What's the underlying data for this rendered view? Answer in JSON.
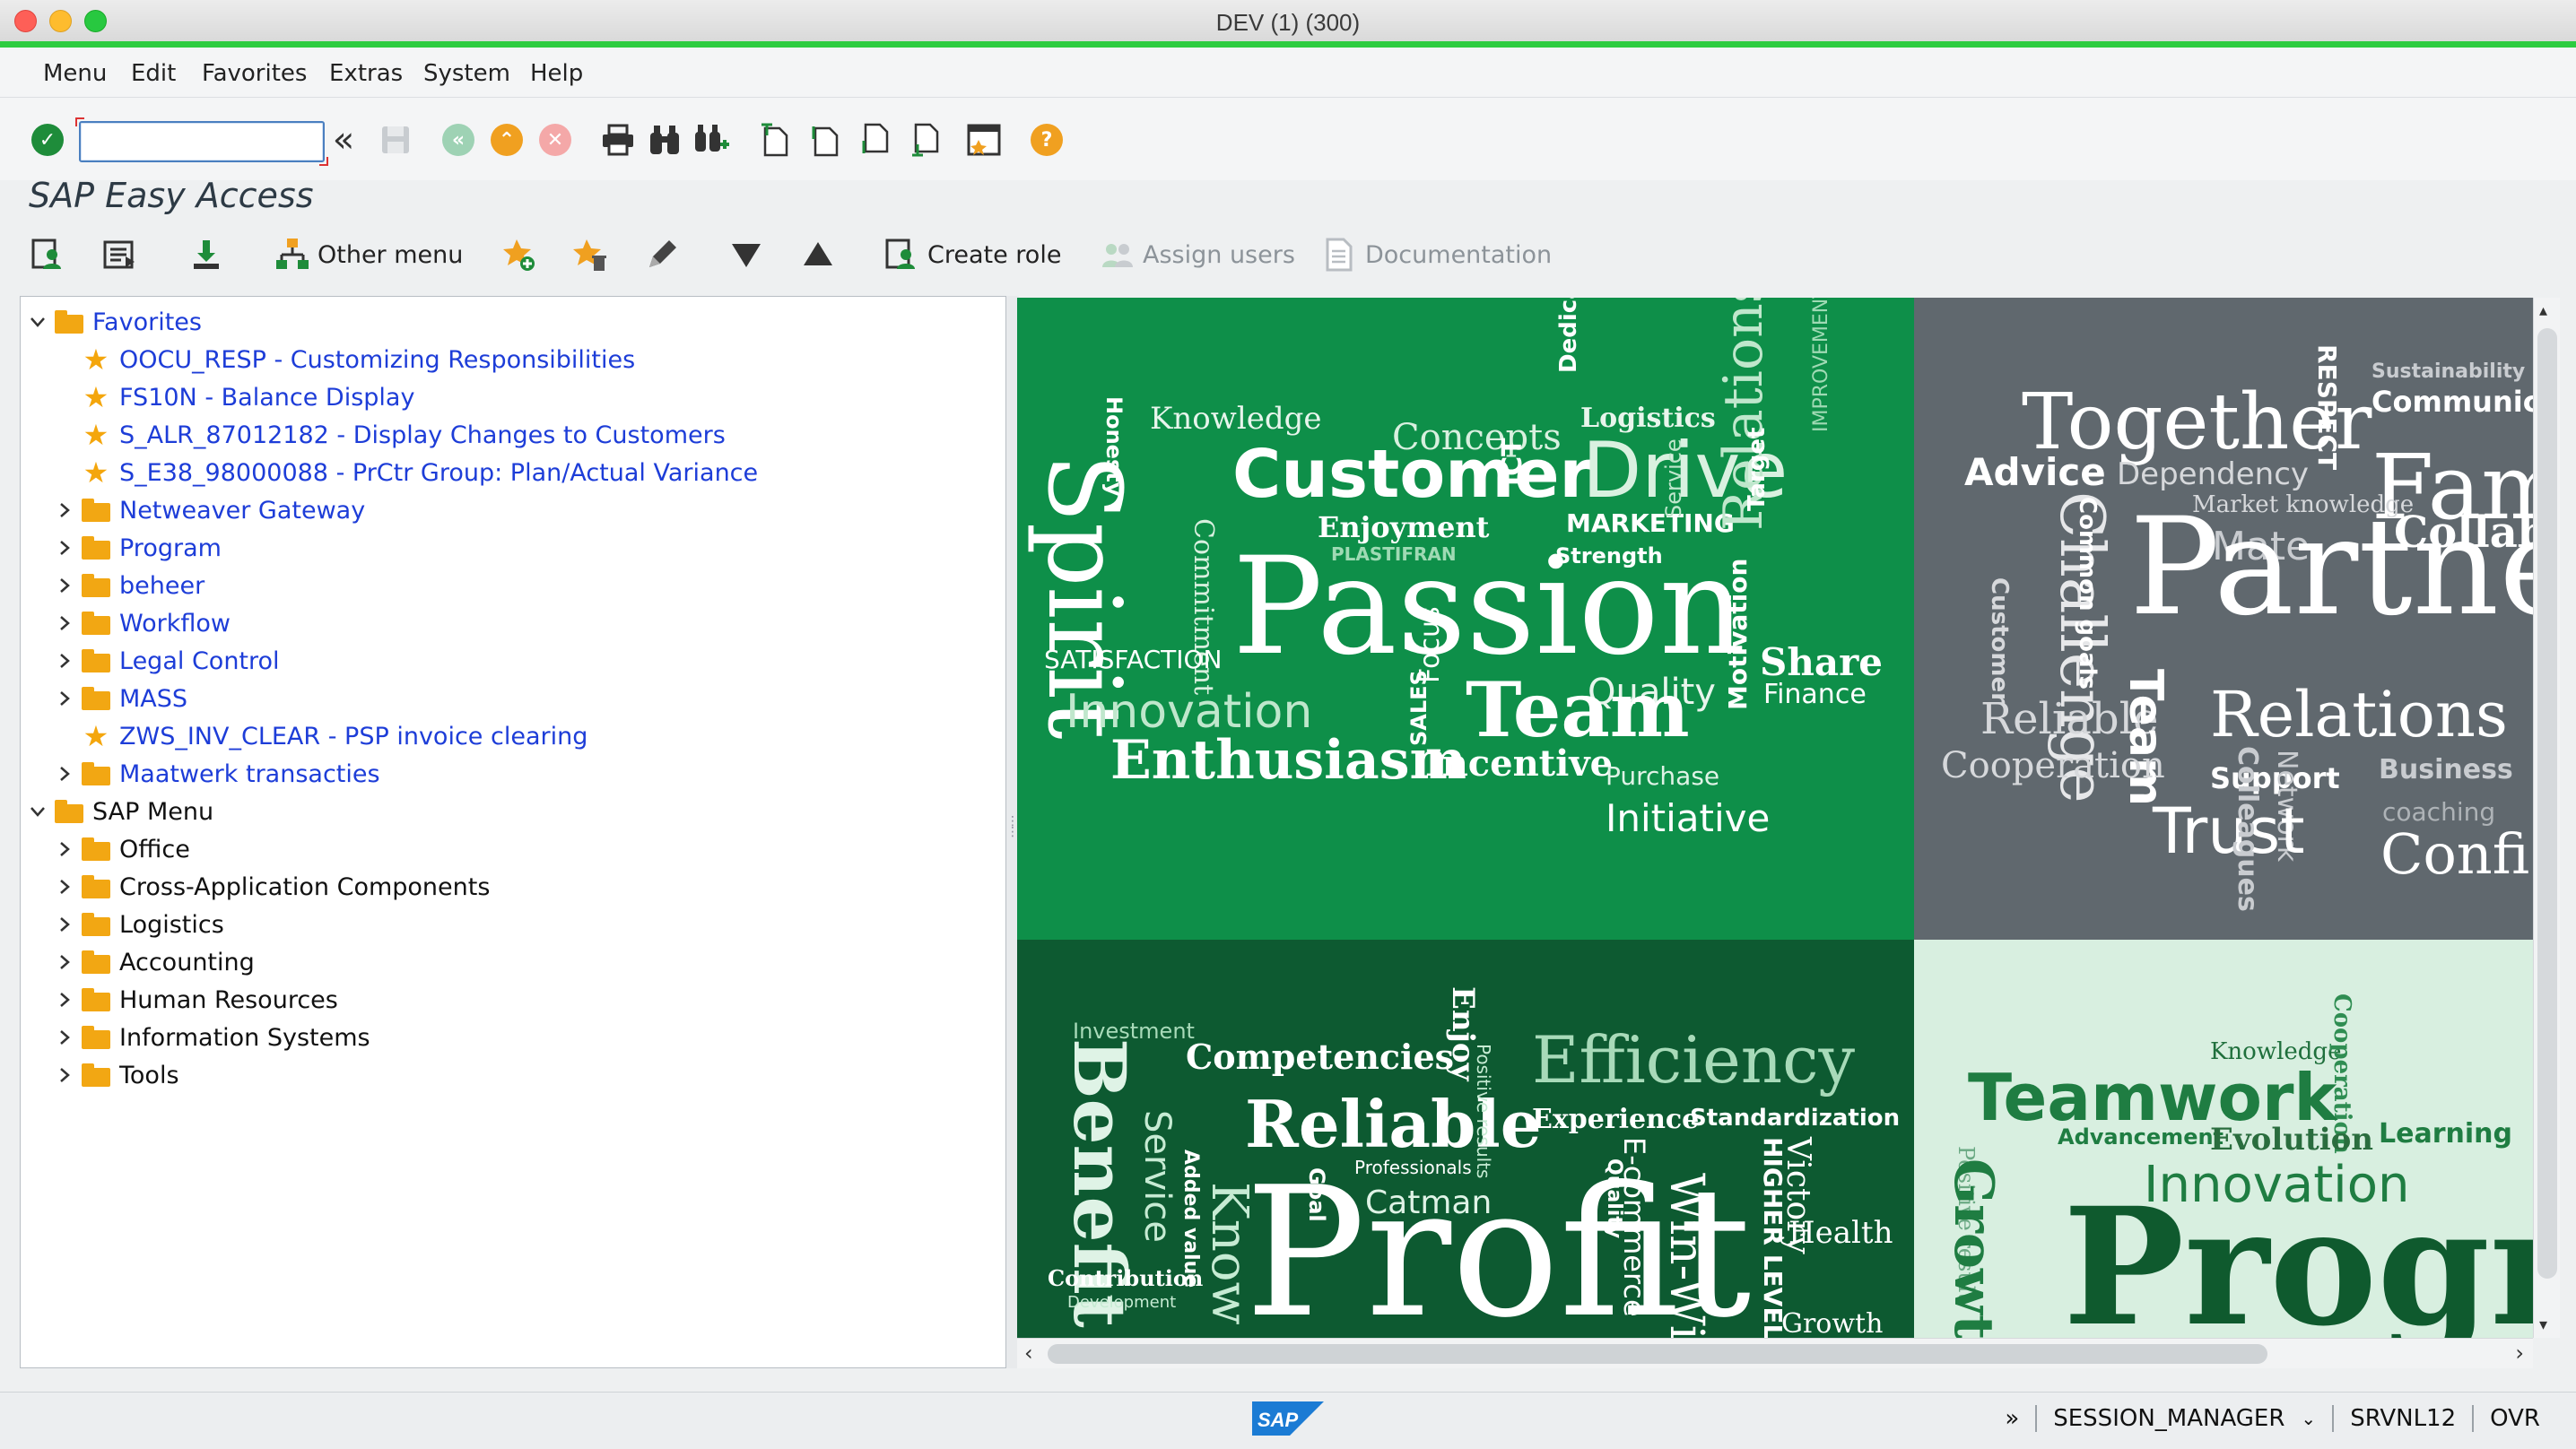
{
  "window": {
    "title": "DEV (1) (300)"
  },
  "menubar": {
    "items": [
      "Menu",
      "Edit",
      "Favorites",
      "Extras",
      "System",
      "Help"
    ]
  },
  "toolbar": {
    "command_field_value": "",
    "icons": [
      "enter-icon",
      "back-double-chevron-icon",
      "save-icon",
      "back-icon",
      "exit-icon",
      "cancel-icon",
      "print-icon",
      "find-icon",
      "find-next-icon",
      "first-page-icon",
      "previous-page-icon",
      "next-page-icon",
      "last-page-icon",
      "create-session-icon",
      "help-icon"
    ]
  },
  "page": {
    "title": "SAP Easy Access"
  },
  "apptoolbar": {
    "other_menu": "Other menu",
    "create_role": "Create role",
    "assign_users": "Assign users",
    "documentation": "Documentation"
  },
  "tree": {
    "favorites_label": "Favorites",
    "favorites": [
      {
        "kind": "star",
        "label": "OOCU_RESP - Customizing Responsibilities"
      },
      {
        "kind": "star",
        "label": "FS10N - Balance Display"
      },
      {
        "kind": "star",
        "label": "S_ALR_87012182 - Display Changes to Customers"
      },
      {
        "kind": "star",
        "label": "S_E38_98000088 - PrCtr Group: Plan/Actual Variance"
      },
      {
        "kind": "folder",
        "label": "Netweaver Gateway"
      },
      {
        "kind": "folder",
        "label": "Program"
      },
      {
        "kind": "folder",
        "label": "beheer"
      },
      {
        "kind": "folder",
        "label": "Workflow"
      },
      {
        "kind": "folder",
        "label": "Legal Control"
      },
      {
        "kind": "folder",
        "label": "MASS"
      },
      {
        "kind": "star",
        "label": "ZWS_INV_CLEAR - PSP invoice clearing"
      },
      {
        "kind": "folder",
        "label": "Maatwerk transacties"
      }
    ],
    "sap_menu_label": "SAP Menu",
    "sap_menu": [
      "Office",
      "Cross-Application Components",
      "Logistics",
      "Accounting",
      "Human Resources",
      "Information Systems",
      "Tools"
    ]
  },
  "wordcloud": {
    "q1": [
      "Knowledge",
      "Concepts",
      "Logistics",
      "Honesty",
      "Dedication",
      "IMPROVEMENT",
      "Spirit",
      "Customer",
      "Drive",
      "Enjoyment",
      "ICT",
      "MARKETING",
      "PLASTIFRAN",
      "Strength",
      "Commitment",
      "Service",
      "Relationship",
      "Target",
      "Passion",
      "SATISFACTION",
      "Share",
      "Quality",
      "Finance",
      "Innovation",
      "Focus",
      "Team",
      "Enthusiasm",
      "SALES",
      "Incentive",
      "Purchase",
      "Motivation",
      "Initiative"
    ],
    "q2": [
      "Sustainability",
      "Together",
      "RESPECT",
      "Communication",
      "Advice",
      "Dependency",
      "Fam",
      "Market knowledge",
      "Mate",
      "Collab",
      "Challenge",
      "Common goals",
      "Customer",
      "Partne",
      "Reliable",
      "Relations",
      "Team",
      "Cooperation",
      "Support",
      "Network",
      "Business",
      "coaching",
      "Trust",
      "Colleagues",
      "Confi"
    ],
    "q3": [
      "Investment",
      "Competencies",
      "Enjoy",
      "Efficiency",
      "Benefit",
      "Service",
      "Reliable",
      "Positive results",
      "Experience",
      "Standardization",
      "Added value",
      "Professionals",
      "Quality",
      "Goal",
      "Catman",
      "E-commerce",
      "Know",
      "HIGHER LEVEL",
      "Victory",
      "Contribution",
      "Development",
      "Profit",
      "Win-Win",
      "Health",
      "Growth"
    ],
    "q4": [
      "Knowledge",
      "Cooperation",
      "Teamwork",
      "Advancement",
      "Evolution",
      "Learning",
      "Positive result",
      "Growth",
      "Innovation",
      "Progre"
    ]
  },
  "statusbar": {
    "chevron": "»",
    "session": "SESSION_MANAGER",
    "server": "SRVNL12",
    "mode": "OVR",
    "logo": "SAP"
  }
}
